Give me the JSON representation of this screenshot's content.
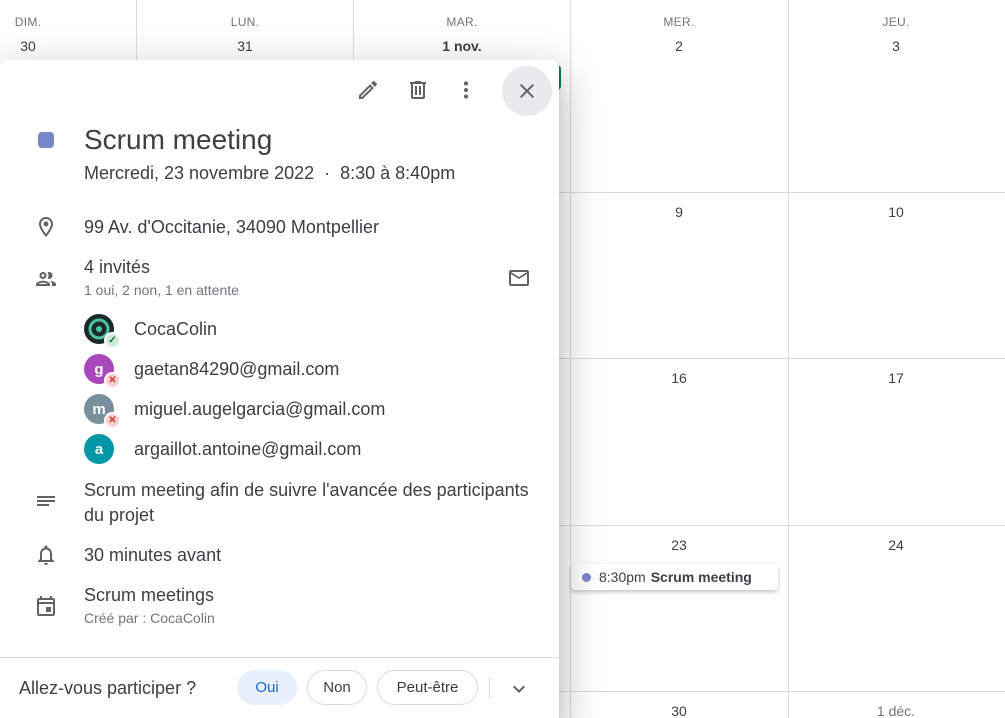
{
  "calendar": {
    "days": [
      {
        "name": "DIM.",
        "date": "30"
      },
      {
        "name": "LUN.",
        "date": "31"
      },
      {
        "name": "MAR.",
        "date": "1 nov."
      },
      {
        "name": "MER.",
        "date": "2"
      },
      {
        "name": "JEU.",
        "date": "3"
      }
    ],
    "week_dates": {
      "wed": [
        "9",
        "16",
        "23",
        "30"
      ],
      "thu": [
        "10",
        "17",
        "24",
        "1 déc."
      ]
    },
    "event": {
      "time": "8:30pm",
      "title": "Scrum meeting",
      "color": "#7986cb"
    }
  },
  "popup": {
    "toolbar": {
      "edit_icon": "pencil-icon",
      "delete_icon": "trash-icon",
      "more_icon": "more-vert-icon",
      "close_icon": "close-icon"
    },
    "title": "Scrum meeting",
    "color": "#7986cb",
    "date": "Mercredi, 23 novembre 2022",
    "separator": "·",
    "time": "8:30 à 8:40pm",
    "location": "99 Av. d'Occitanie, 34090 Montpellier",
    "guests": {
      "count_label": "4 invités",
      "summary": "1 oui, 2 non, 1 en attente",
      "list": [
        {
          "name": "CocaColin",
          "initial": "",
          "avatar_color": "#1b2a2a",
          "status": "yes"
        },
        {
          "name": "gaetan84290@gmail.com",
          "initial": "g",
          "avatar_color": "#ab47bc",
          "status": "no"
        },
        {
          "name": "miguel.augelgarcia@gmail.com",
          "initial": "m",
          "avatar_color": "#78909c",
          "status": "no"
        },
        {
          "name": "argaillot.antoine@gmail.com",
          "initial": "a",
          "avatar_color": "#0097a7",
          "status": "pending"
        }
      ]
    },
    "description": "Scrum meeting afin de suivre l'avancée des participants du projet",
    "reminder": "30 minutes avant",
    "calendar_name": "Scrum meetings",
    "created_by": "Créé par : CocaColin",
    "rsvp": {
      "question": "Allez-vous participer ?",
      "yes": "Oui",
      "no": "Non",
      "maybe": "Peut-être",
      "selected": "yes"
    }
  }
}
